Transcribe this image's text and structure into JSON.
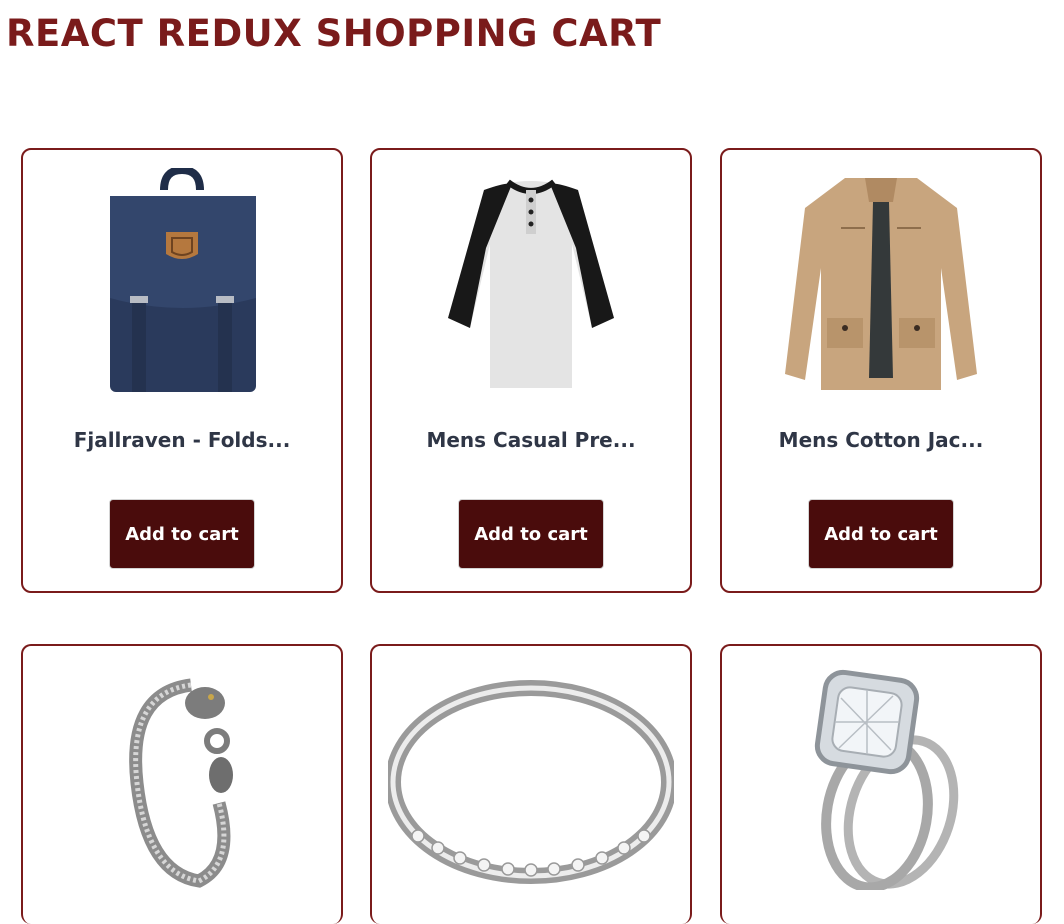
{
  "header": {
    "title": "REACT REDUX SHOPPING CART"
  },
  "colors": {
    "accent": "#7a1b1b",
    "button_bg": "#4a0c0c",
    "title_text": "#2f3646"
  },
  "products": [
    {
      "title": "Fjallraven - Folds...",
      "button_label": "Add to cart",
      "icon": "backpack-image"
    },
    {
      "title": "Mens Casual Pre...",
      "button_label": "Add to cart",
      "icon": "raglan-tshirt-image"
    },
    {
      "title": "Mens Cotton Jac...",
      "button_label": "Add to cart",
      "icon": "cotton-jacket-image"
    },
    {
      "title": "",
      "button_label": "",
      "icon": "dragon-bracelet-image"
    },
    {
      "title": "",
      "button_label": "",
      "icon": "silver-bangle-image"
    },
    {
      "title": "",
      "button_label": "",
      "icon": "diamond-ring-image"
    }
  ]
}
